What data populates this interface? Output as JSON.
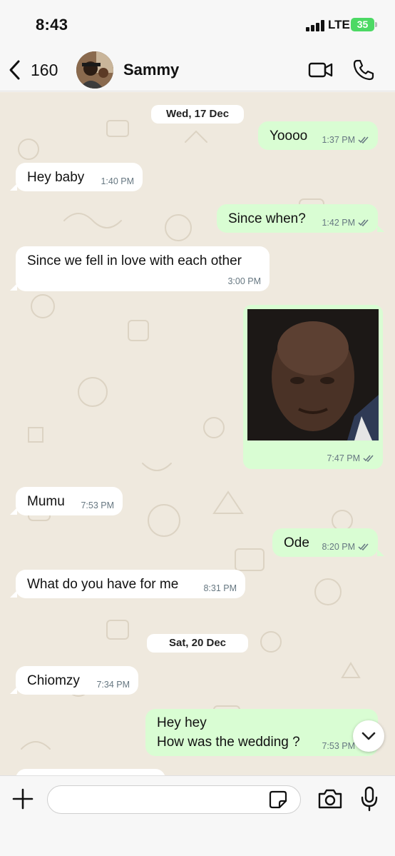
{
  "status_bar": {
    "time": "8:43",
    "network": "LTE",
    "battery": "35"
  },
  "header": {
    "back_count": "160",
    "contact_name": "Sammy"
  },
  "dates": [
    "Wed, 17 Dec",
    "Sat, 20 Dec"
  ],
  "messages": [
    {
      "dir": "out",
      "text": "Yoooo",
      "time": "1:37 PM",
      "read": true
    },
    {
      "dir": "in",
      "text": "Hey baby",
      "time": "1:40 PM"
    },
    {
      "dir": "out",
      "text": "Since when?",
      "time": "1:42 PM",
      "read": true
    },
    {
      "dir": "in",
      "text": "Since we fell in love with each other",
      "time": "3:00 PM"
    },
    {
      "dir": "out",
      "type": "image",
      "time": "7:47 PM",
      "read": true
    },
    {
      "dir": "in",
      "text": "Mumu",
      "time": "7:53 PM"
    },
    {
      "dir": "out",
      "text": "Ode",
      "time": "8:20 PM",
      "read": true
    },
    {
      "dir": "in",
      "text": "What do you have for me",
      "time": "8:31 PM"
    },
    {
      "dir": "in",
      "text": "Chiomzy",
      "time": "7:34 PM"
    },
    {
      "dir": "out",
      "text_line1": "Hey hey",
      "text_line2": "How was the wedding ?",
      "time": "7:53 PM",
      "read": true
    }
  ],
  "input": {
    "value": "",
    "placeholder": ""
  },
  "colors": {
    "incoming": "#ffffff",
    "outgoing": "#d9fdd3",
    "wallpaper": "#efe9de",
    "battery": "#4cd964",
    "meta": "#667781"
  },
  "icons": [
    "back-chevron-icon",
    "video-call-icon",
    "phone-call-icon",
    "plus-icon",
    "sticker-icon",
    "camera-icon",
    "microphone-icon",
    "chevron-down-icon",
    "double-check-icon"
  ]
}
